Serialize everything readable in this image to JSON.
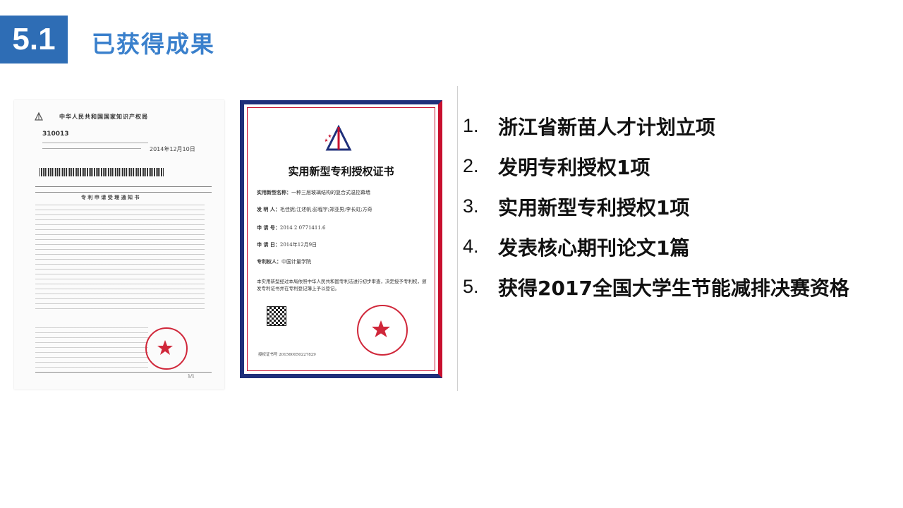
{
  "header": {
    "section_number": "5.1",
    "title": "已获得成果"
  },
  "notice": {
    "title": "中华人民共和国国家知识产权局",
    "postcode": "310013",
    "date": "2014年12月10日",
    "doc_title": "专 利 申 请 受 理 通 知 书",
    "page_number": "1/1"
  },
  "certificate": {
    "title": "实用新型专利授权证书",
    "fields": [
      {
        "label": "实用新型名称：",
        "value": "一种三层玻璃结构的复合式温控幕墙"
      },
      {
        "label": "发 明 人：",
        "value": "毛佳妮;江述帆;彭程宇;郑亚男;李长虹;方奇"
      },
      {
        "label": "申 请 号：",
        "value": "2014 2 0771411.6"
      },
      {
        "label": "申 请 日：",
        "value": "2014年12月9日"
      },
      {
        "label": "专利权人：",
        "value": "中国计量学院"
      }
    ],
    "statement": "本实用新型经过本局依照中华人民共和国专利法进行初步审查，决定授予专利权，颁发专利证书并在专利登记簿上予以登记。",
    "cert_no": "授权证书号 201560050227829"
  },
  "achievements": [
    {
      "num": "1.",
      "text": "浙江省新苗人才计划立项"
    },
    {
      "num": "2.",
      "text": "发明专利授权1项"
    },
    {
      "num": "3.",
      "text": "实用新型专利授权1项"
    },
    {
      "num": "4.",
      "text": "发表核心期刊论文1篇"
    },
    {
      "num": "5.",
      "text": "获得2017全国大学生节能减排决赛资格"
    }
  ],
  "colors": {
    "badge": "#2e6db5",
    "title": "#3a80cc",
    "cert_border_blue": "#1f2f7a",
    "cert_border_red": "#c8102e"
  }
}
